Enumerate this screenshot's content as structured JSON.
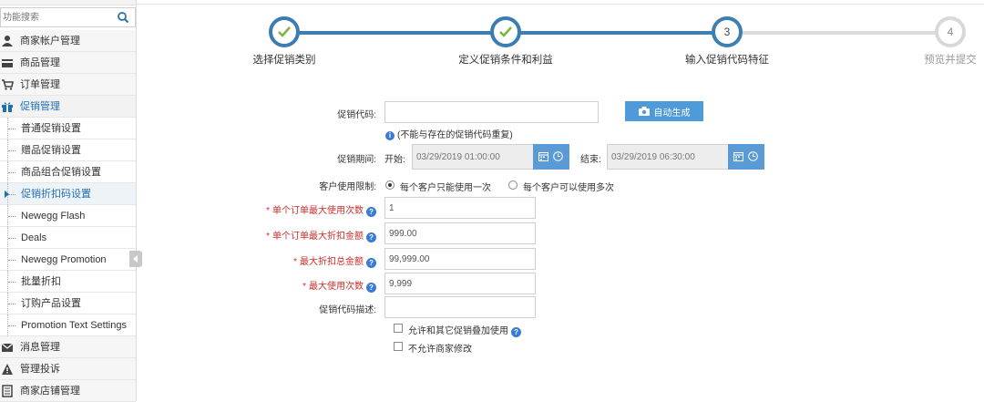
{
  "sidebar": {
    "search_placeholder": "功能搜索",
    "items": [
      {
        "label": "商家帐户管理",
        "icon": "user-icon"
      },
      {
        "label": "商品管理",
        "icon": "card-icon"
      },
      {
        "label": "订单管理",
        "icon": "cart-icon"
      },
      {
        "label": "促销管理",
        "icon": "gift-icon"
      },
      {
        "label": "普通促销设置"
      },
      {
        "label": "赠品促销设置"
      },
      {
        "label": "商品组合促销设置"
      },
      {
        "label": "促销折扣码设置"
      },
      {
        "label": "Newegg Flash"
      },
      {
        "label": "Deals"
      },
      {
        "label": "Newegg Promotion"
      },
      {
        "label": "批量折扣"
      },
      {
        "label": "订购产品设置"
      },
      {
        "label": "Promotion Text Settings"
      },
      {
        "label": "消息管理",
        "icon": "envelope-icon"
      },
      {
        "label": "管理投诉",
        "icon": "warning-icon"
      },
      {
        "label": "商家店铺管理",
        "icon": "store-icon"
      }
    ]
  },
  "wizard": {
    "steps": [
      {
        "label": "选择促销类别",
        "state": "done"
      },
      {
        "label": "定义促销条件和利益",
        "state": "done"
      },
      {
        "label": "输入促销代码特征",
        "state": "current",
        "num": "3"
      },
      {
        "label": "预览并提交",
        "state": "todo",
        "num": "4"
      }
    ],
    "colors": {
      "done": "#3b7cb2",
      "todo": "#d8d8d8",
      "check": "#7cb342"
    }
  },
  "form": {
    "promo_code_label": "促销代码:",
    "promo_code_value": "",
    "auto_generate_label": "自动生成",
    "promo_code_hint": "(不能与存在的促销代码重复)",
    "period_label": "促销期间:",
    "start_label": "开始:",
    "start_value": "03/29/2019 01:00:00",
    "end_label": "结束:",
    "end_value": "03/29/2019 06:30:00",
    "customer_limit_label": "客户使用限制:",
    "radio_once": "每个客户只能使用一次",
    "radio_multi": "每个客户可以使用多次",
    "max_uses_per_order_label": "单个订单最大使用次数",
    "max_uses_per_order_value": "1",
    "max_discount_per_order_label": "单个订单最大折扣金额",
    "max_discount_per_order_value": "999.00",
    "max_discount_total_label": "最大折扣总金额",
    "max_discount_total_value": "99,999.00",
    "max_uses_label": "最大使用次数",
    "max_uses_value": "9,999",
    "description_label": "促销代码描述:",
    "description_value": "",
    "allow_stack_label": "允许和其它促销叠加使用",
    "disallow_edit_label": "不允许商家修改"
  }
}
